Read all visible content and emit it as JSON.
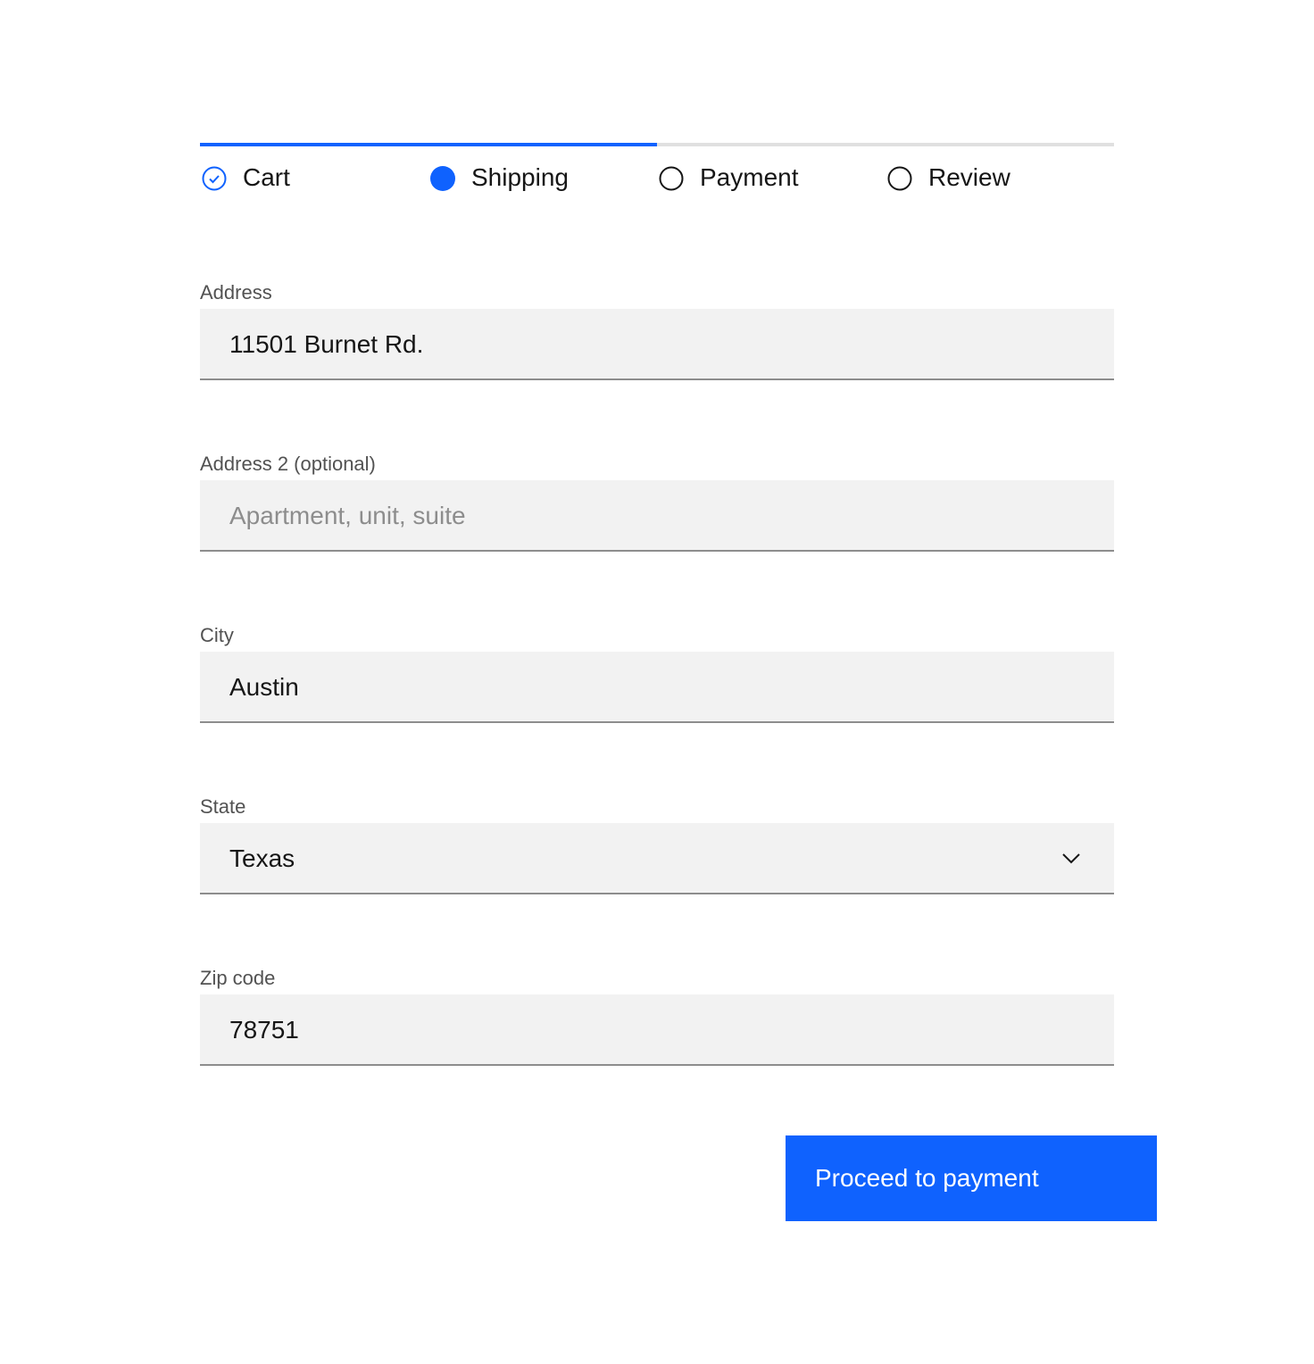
{
  "progress": {
    "steps": [
      {
        "label": "Cart",
        "state": "complete"
      },
      {
        "label": "Shipping",
        "state": "current"
      },
      {
        "label": "Payment",
        "state": "incomplete"
      },
      {
        "label": "Review",
        "state": "incomplete"
      }
    ]
  },
  "form": {
    "address": {
      "label": "Address",
      "value": "11501 Burnet Rd."
    },
    "address2": {
      "label": "Address 2 (optional)",
      "placeholder": "Apartment, unit, suite"
    },
    "city": {
      "label": "City",
      "value": "Austin"
    },
    "state": {
      "label": "State",
      "value": "Texas"
    },
    "zip": {
      "label": "Zip code",
      "value": "78751"
    }
  },
  "actions": {
    "proceed_label": "Proceed to payment"
  },
  "colors": {
    "accent": "#0f62fe",
    "field_bg": "#f2f2f2",
    "border": "#8d8d8d"
  }
}
